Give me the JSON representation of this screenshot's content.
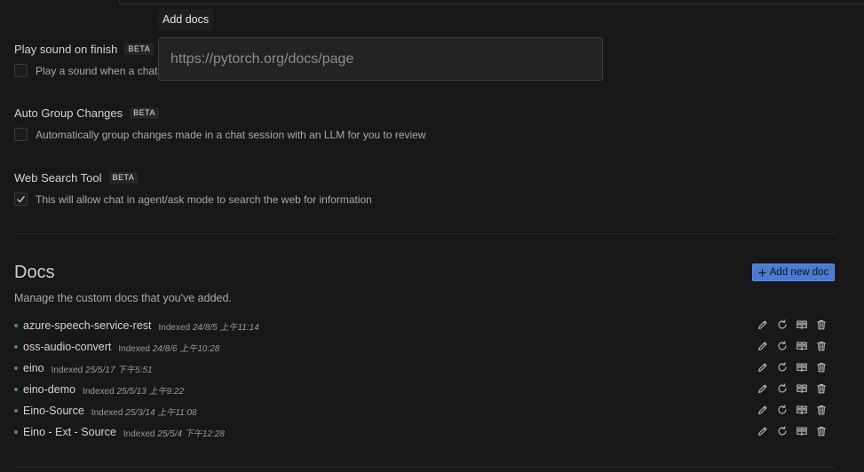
{
  "settings": [
    {
      "title": "Play sound on finish",
      "badge": "BETA",
      "description": "Play a sound when a chat",
      "checked": false
    },
    {
      "title": "Auto Group Changes",
      "badge": "BETA",
      "description": "Automatically group changes made in a chat session with an LLM for you to review",
      "checked": false
    },
    {
      "title": "Web Search Tool",
      "badge": "BETA",
      "description": "This will allow chat in agent/ask mode to search the web for information",
      "checked": true
    }
  ],
  "docs": {
    "title": "Docs",
    "description": "Manage the custom docs that you've added.",
    "add_button": "Add new doc",
    "indexed_label": "Indexed",
    "items": [
      {
        "name": "azure-speech-service-rest",
        "date": "24/8/5 上午11:14"
      },
      {
        "name": "oss-audio-convert",
        "date": "24/8/6 上午10:28"
      },
      {
        "name": "eino",
        "date": "25/5/17 下午5:51"
      },
      {
        "name": "eino-demo",
        "date": "25/5/13 上午9:22"
      },
      {
        "name": "Eino-Source",
        "date": "25/3/14 上午11:08"
      },
      {
        "name": "Eino - Ext - Source",
        "date": "25/5/4 下午12:28"
      }
    ]
  },
  "popup": {
    "tooltip": "Add docs",
    "input_placeholder": "https://pytorch.org/docs/page",
    "input_value": ""
  },
  "icons": {
    "item_actions": [
      "pencil-icon",
      "refresh-icon",
      "book-icon",
      "trash-icon"
    ],
    "status_dot": "status-dot",
    "check": "checkmark-icon",
    "add": "plus-icon"
  },
  "colors": {
    "background": "#181818",
    "accent": "#4a7bd1",
    "status_dot": "#2ea043"
  }
}
